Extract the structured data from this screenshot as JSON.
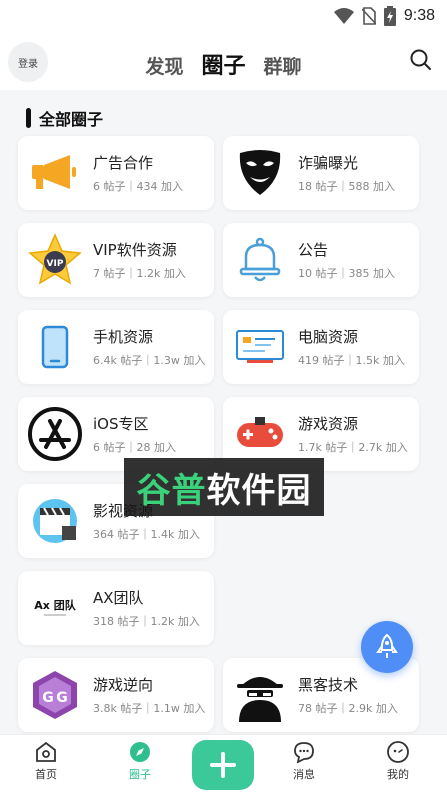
{
  "status": {
    "time": "9:38"
  },
  "header": {
    "login_label": "登录",
    "tabs": [
      {
        "label": "发现",
        "active": false
      },
      {
        "label": "圈子",
        "active": true
      },
      {
        "label": "群聊",
        "active": false
      }
    ]
  },
  "section": {
    "title": "全部圈子"
  },
  "circles": [
    {
      "name": "广告合作",
      "stats": "6 帖子｜434 加入",
      "icon": "megaphone-icon"
    },
    {
      "name": "诈骗曝光",
      "stats": "18 帖子｜588 加入",
      "icon": "mask-icon"
    },
    {
      "name": "VIP软件资源",
      "stats": "7 帖子｜1.2k 加入",
      "icon": "vip-star-icon"
    },
    {
      "name": "公告",
      "stats": "10 帖子｜385 加入",
      "icon": "bell-icon"
    },
    {
      "name": "手机资源",
      "stats": "6.4k 帖子｜1.3w 加入",
      "icon": "phone-icon"
    },
    {
      "name": "电脑资源",
      "stats": "419 帖子｜1.5k 加入",
      "icon": "computer-icon"
    },
    {
      "name": "iOS专区",
      "stats": "6 帖子｜28 加入",
      "icon": "app-store-icon"
    },
    {
      "name": "游戏资源",
      "stats": "1.7k 帖子｜2.7k 加入",
      "icon": "gamepad-icon"
    },
    {
      "name": "影视资源",
      "stats": "364 帖子｜1.4k 加入",
      "icon": "clapperboard-icon"
    },
    {
      "name": "AX团队",
      "stats": "318 帖子｜1.2k 加入",
      "icon": "ax-team-logo"
    },
    {
      "name": "游戏逆向",
      "stats": "3.8k 帖子｜1.1w 加入",
      "icon": "game-guardian-icon"
    },
    {
      "name": "黑客技术",
      "stats": "78 帖子｜2.9k 加入",
      "icon": "hacker-icon"
    }
  ],
  "watermark": {
    "text_green": "谷普",
    "text_white": "软件园"
  },
  "bottom_nav": [
    {
      "label": "首页",
      "icon": "home-icon",
      "active": false
    },
    {
      "label": "圈子",
      "icon": "compass-icon",
      "active": true
    },
    {
      "label": "消息",
      "icon": "message-icon",
      "active": false
    },
    {
      "label": "我的",
      "icon": "profile-icon",
      "active": false
    }
  ],
  "colors": {
    "accent": "#3cc99a",
    "fab": "#4f8ef7",
    "background": "#f5f6f8"
  }
}
